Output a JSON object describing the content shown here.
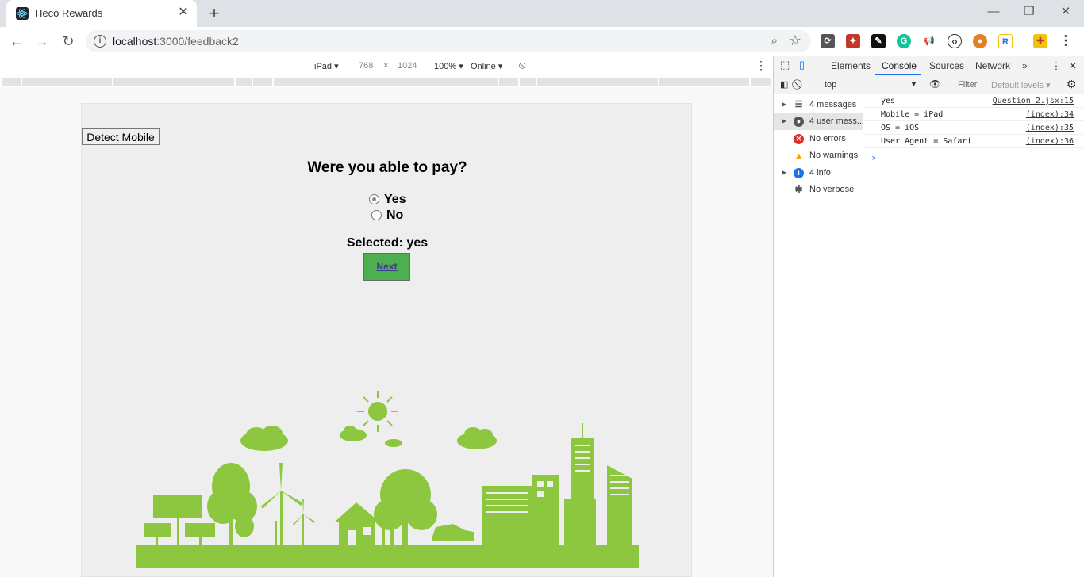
{
  "browser": {
    "tab_title": "Heco Rewards",
    "url_host": "localhost",
    "url_rest": ":3000/feedback2"
  },
  "device_toolbar": {
    "device": "iPad",
    "width": "768",
    "times": "×",
    "height": "1024",
    "zoom": "100%",
    "network": "Online"
  },
  "page": {
    "detect_button": "Detect Mobile",
    "question": "Were you able to pay?",
    "options": [
      {
        "label": "Yes",
        "checked": true
      },
      {
        "label": "No",
        "checked": false
      }
    ],
    "selected_text": "Selected: yes",
    "next_label": "Next"
  },
  "devtools": {
    "tabs": [
      "Elements",
      "Console",
      "Sources",
      "Network"
    ],
    "active_tab": "Console",
    "context": "top",
    "filter_placeholder": "Filter",
    "levels": "Default levels",
    "sidebar": [
      {
        "label": "4 messages",
        "icon": "list-icon"
      },
      {
        "label": "4 user mess...",
        "icon": "user-icon"
      },
      {
        "label": "No errors",
        "icon": "error-icon"
      },
      {
        "label": "No warnings",
        "icon": "warning-icon"
      },
      {
        "label": "4 info",
        "icon": "info-icon"
      },
      {
        "label": "No verbose",
        "icon": "bug-icon"
      }
    ],
    "logs": [
      {
        "message": "yes",
        "source": "Question 2.jsx:15"
      },
      {
        "message": "Mobile = iPad",
        "source": "(index):34"
      },
      {
        "message": "OS = iOS",
        "source": "(index):35"
      },
      {
        "message": "User Agent = Safari",
        "source": "(index):36"
      }
    ]
  }
}
